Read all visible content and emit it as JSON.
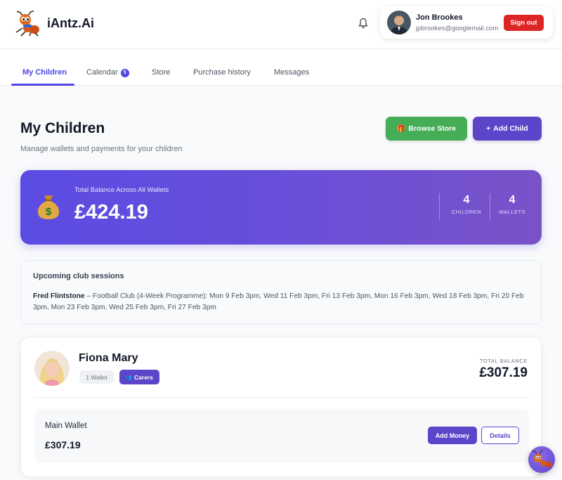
{
  "app": {
    "brand": "iAntz.Ai",
    "logo_icon": "ant-mascot-icon"
  },
  "header": {
    "notifications_icon": "bell-icon",
    "user": {
      "name": "Jon Brookes",
      "email": "jpbrookes@googlemail.com",
      "sign_out_label": "Sign out"
    }
  },
  "tabs": [
    {
      "label": "My Children",
      "active": true
    },
    {
      "label": "Calendar",
      "badge": "5"
    },
    {
      "label": "Store"
    },
    {
      "label": "Purchase history"
    },
    {
      "label": "Messages"
    }
  ],
  "page": {
    "title": "My Children",
    "subtitle": "Manage wallets and payments for your children",
    "browse_store_label": "Browse Store",
    "add_child_label": "Add Child"
  },
  "balance": {
    "label": "Total Balance Across All Wallets",
    "value": "£424.19",
    "children_count": "4",
    "children_label": "CHILDREN",
    "wallets_count": "4",
    "wallets_label": "WALLETS"
  },
  "sessions": {
    "title": "Upcoming club sessions",
    "child": "Fred Flintstone",
    "separator": " – ",
    "details": "Football Club (4-Week Programme): Mon 9 Feb 3pm, Wed 11 Feb 3pm, Fri 13 Feb 3pm, Mon 16 Feb 3pm, Wed 18 Feb 3pm, Fri 20 Feb 3pm, Mon 23 Feb 3pm, Wed 25 Feb 3pm, Fri 27 Feb 3pm"
  },
  "children": [
    {
      "name": "Fiona Mary",
      "wallet_tag": "1 Wallet",
      "carers_label": "Carers",
      "total_balance_label": "TOTAL BALANCE",
      "total_balance": "£307.19",
      "wallets": [
        {
          "name": "Main Wallet",
          "balance": "£307.19",
          "add_money_label": "Add Money",
          "details_label": "Details"
        }
      ]
    }
  ],
  "colors": {
    "primary": "#5d45c9",
    "success": "#44ad55",
    "danger": "#dc2626"
  }
}
